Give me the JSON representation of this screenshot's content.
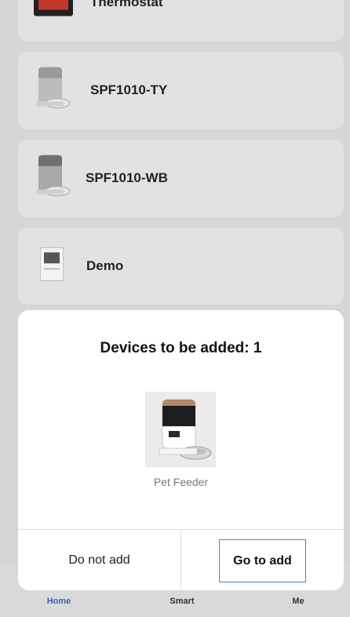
{
  "device_list": [
    {
      "name": "Thermostat"
    },
    {
      "name": "SPF1010-TY"
    },
    {
      "name": "SPF1010-WB"
    },
    {
      "name": "Demo"
    }
  ],
  "tabbar": {
    "home_label": "Home",
    "smart_label": "Smart",
    "me_label": "Me",
    "active_tab": "Home",
    "active_color": "#3b5fb6"
  },
  "dialog": {
    "title": "Devices to be added: 1",
    "device_name": "Pet Feeder",
    "cancel_label": "Do not add",
    "confirm_label": "Go to add"
  }
}
